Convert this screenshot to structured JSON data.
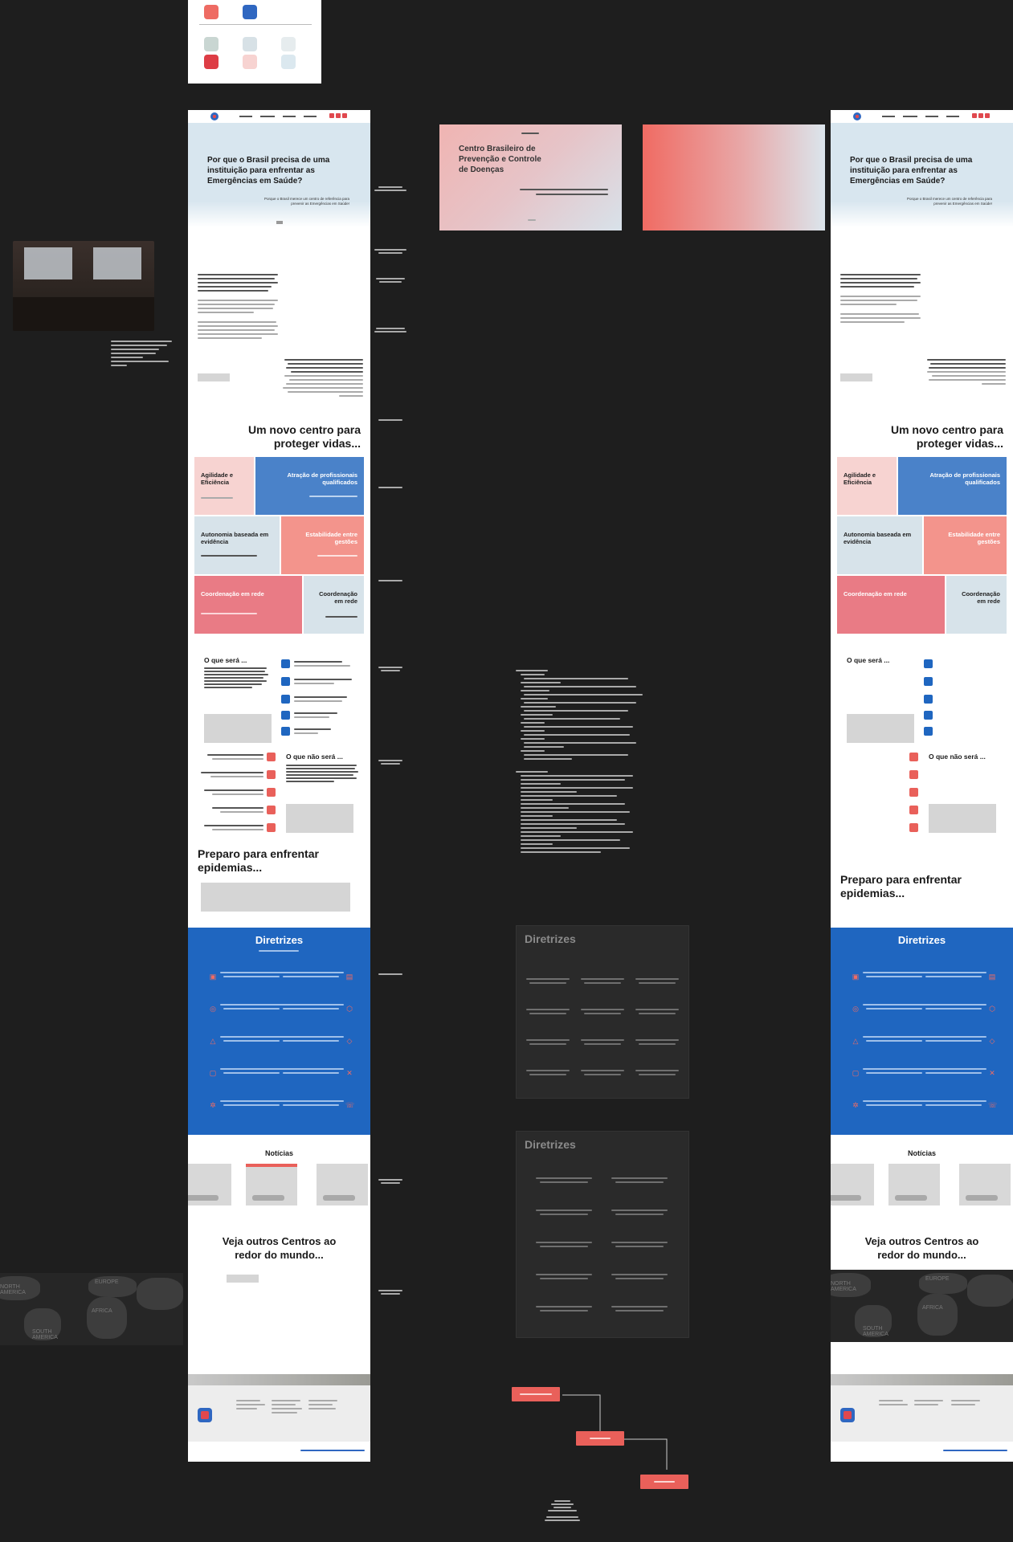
{
  "palette_card": {
    "swatches": [
      "#ee6b63",
      "#2f67c1",
      "#c9d6d2",
      "#d7e1e6",
      "#e6ecee",
      "#dd3d45",
      "#f7d3d1",
      "#dbe8ef"
    ]
  },
  "hero": {
    "title": "Por que o Brasil precisa de uma instituição para enfrentar as Emergências em Saúde?",
    "subtitle": "Porque o Brasil merece um centro de referência para prevenir as Emergências em Saúde!"
  },
  "hero_variant": {
    "title": "Centro Brasileiro de Prevenção e Controle de Doenças"
  },
  "section_new_center": {
    "title": "Um novo centro para proteger vidas...",
    "cards": [
      {
        "title": "Agilidade e Eficiência",
        "color": "#f7d3d1",
        "text_color": "#1a1a1a"
      },
      {
        "title": "Atração de profissionais qualificados",
        "color": "#4a82c9",
        "text_color": "#ffffff"
      },
      {
        "title": "Autonomia baseada em evidência",
        "color": "#d7e3ea",
        "text_color": "#1a1a1a"
      },
      {
        "title": "Estabilidade entre gestões",
        "color": "#f3948c",
        "text_color": "#ffffff"
      },
      {
        "title": "Coordenação em rede",
        "color": "#e97b85",
        "text_color": "#ffffff"
      },
      {
        "title": "Coordenação em rede",
        "color": "#d7e3ea",
        "text_color": "#1a1a1a"
      }
    ]
  },
  "section_what": {
    "title_is": "O que será ...",
    "title_is_not": "O que não será ..."
  },
  "section_prepare": {
    "title": "Preparo para enfrentar epidemias..."
  },
  "section_guidelines": {
    "title": "Diretrizes",
    "dark_title_1": "Diretrizes",
    "dark_title_2": "Diretrizes"
  },
  "section_news": {
    "title": "Notícias"
  },
  "section_world": {
    "title": "Veja outros Centros ao redor do mundo..."
  },
  "map": {
    "labels": [
      "EUROPE",
      "AFRICA",
      "SOUTH AMERICA",
      "NORTH AMERICA"
    ]
  },
  "flow": {
    "nodes": [
      "",
      "",
      ""
    ]
  },
  "colors": {
    "brand_red": "#e9605a",
    "brand_blue": "#1f66c0",
    "canvas": "#1e1e1e"
  }
}
